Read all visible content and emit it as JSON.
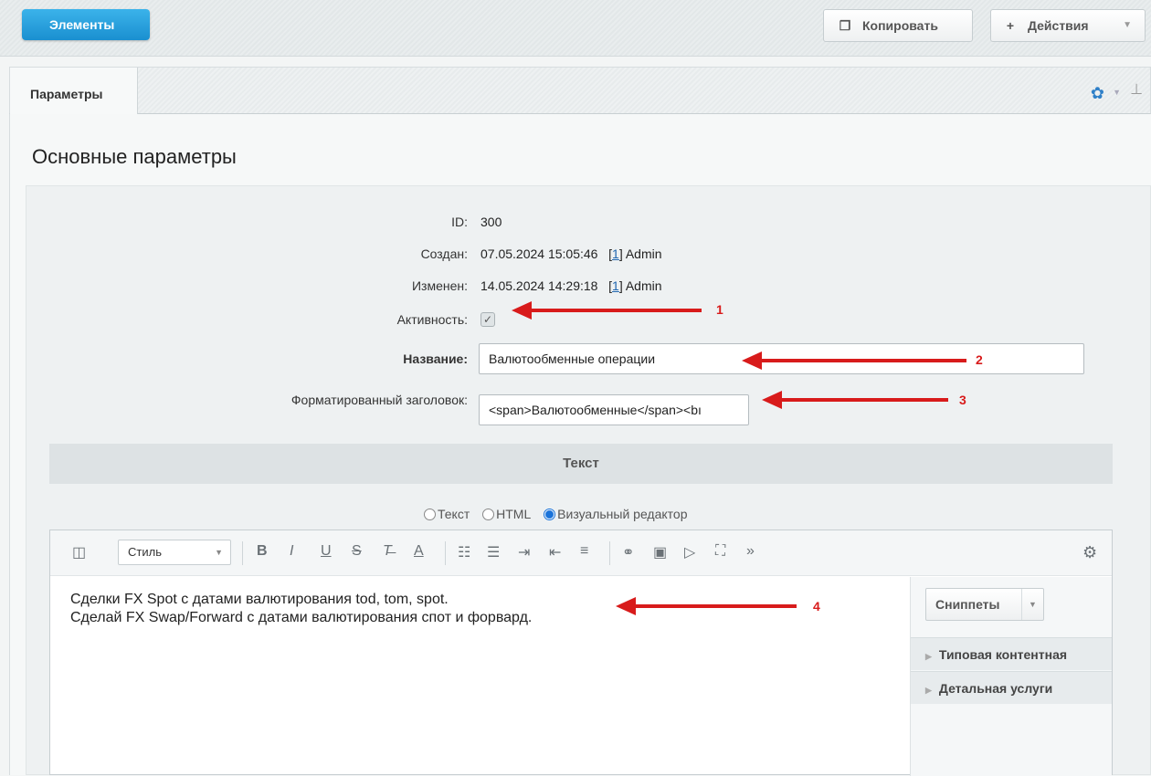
{
  "topbar": {
    "breadcrumb": "Элементы",
    "copy_label": "Копировать",
    "actions_label": "Действия"
  },
  "tabs": [
    {
      "label": "Параметры"
    }
  ],
  "section": {
    "title": "Основные параметры"
  },
  "fields": {
    "id": {
      "label": "ID:",
      "value": "300"
    },
    "created": {
      "label": "Создан:",
      "value": "07.05.2024 15:05:46",
      "user_link": "1",
      "user": "Admin"
    },
    "modified": {
      "label": "Изменен:",
      "value": "14.05.2024 14:29:18",
      "user_link": "1",
      "user": "Admin"
    },
    "active": {
      "label": "Активность:",
      "checked": true
    },
    "name": {
      "label": "Название:",
      "value": "Валютообменные операции"
    },
    "formatted_title": {
      "label": "Форматированный заголовок:",
      "value": "<span>Валютообменные</span><bı"
    }
  },
  "text_section": {
    "header": "Текст",
    "modes": [
      {
        "label": "Текст",
        "selected": false
      },
      {
        "label": "HTML",
        "selected": false
      },
      {
        "label": "Визуальный редактор",
        "selected": true
      }
    ]
  },
  "editor": {
    "style_label": "Стиль",
    "content_lines": [
      "Сделки FX Spot с датами валютирования tod, tom, spot.",
      "Сделай FX Swap/Forward с датами валютирования спот и форвард."
    ],
    "snippets_label": "Сниппеты",
    "categories": [
      "Типовая контентная",
      "Детальная услуги"
    ]
  },
  "annotations": [
    "1",
    "2",
    "3",
    "4"
  ],
  "colors": {
    "accent": "#1a8fd0",
    "annotation": "#d81b1b",
    "link": "#2067b0"
  }
}
